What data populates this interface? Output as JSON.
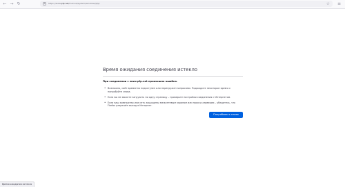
{
  "browser": {
    "url_prefix": "https://www.",
    "url_domain": "pfp.net",
    "url_path": "/manual/system/windows/pfp/",
    "icons": {
      "back": "back-arrow-icon",
      "forward": "forward-arrow-icon",
      "reload": "reload-icon",
      "site_info": "page-icon",
      "bookmark": "star-icon",
      "menu": "hamburger-menu-icon"
    }
  },
  "error": {
    "title": "Время ожидания соединения истекло",
    "subtitle": "При соединении с www.pfp.net произошла ошибка.",
    "bullets": [
      "Возможно, сайт временно недоступен или перегружен запросами. Подождите некоторое время и попробуйте снова.",
      "Если вы не можете загрузить ни одну страницу – проверьте настройки соединения с Интернетом.",
      "Если ваш компьютер или сеть защищены межсетевым экраном или прокси-сервером – убедитесь, что Firefox разрешён выход в Интернет."
    ],
    "retry_label": "Попробовать снова"
  },
  "status_bar": {
    "text": "Время ожидания истекло"
  },
  "colors": {
    "accent": "#0061e0",
    "toolbar": "#f9f9fb",
    "urlbar": "#f0f0f4"
  }
}
